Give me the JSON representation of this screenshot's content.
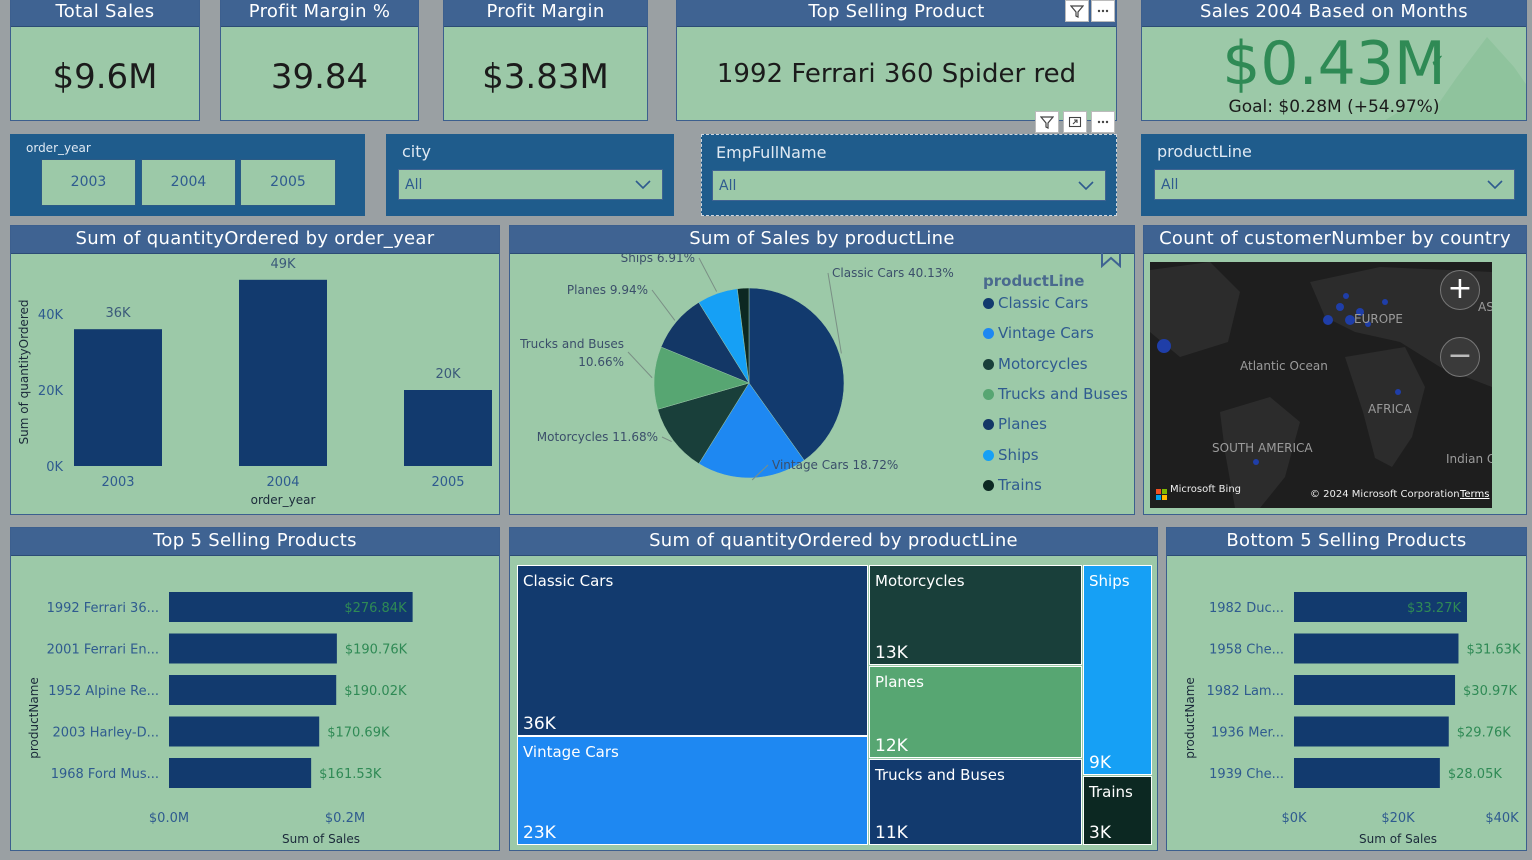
{
  "kpis": {
    "total_sales": {
      "title": "Total Sales",
      "value": "$9.6M"
    },
    "profit_margin_pct": {
      "title": "Profit Margin %",
      "value": "39.84"
    },
    "profit_margin": {
      "title": "Profit Margin",
      "value": "$3.83M"
    },
    "top_product": {
      "title": "Top Selling Product",
      "value": "1992 Ferrari 360 Spider red"
    },
    "sales_2004": {
      "title": "Sales 2004 Based on Months",
      "value": "$0.43M",
      "goal": "Goal: $0.28M (+54.97%)"
    }
  },
  "slicers": {
    "order_year": {
      "title": "order_year",
      "options": [
        "2003",
        "2004",
        "2005"
      ]
    },
    "city": {
      "title": "city",
      "value": "All"
    },
    "emp": {
      "title": "EmpFullName",
      "value": "All"
    },
    "product_line": {
      "title": "productLine",
      "value": "All"
    }
  },
  "visuals": {
    "qty_by_year": {
      "title": "Sum of quantityOrdered by order_year"
    },
    "sales_by_line": {
      "title": "Sum of Sales by productLine"
    },
    "customers_by_country": {
      "title": "Count of customerNumber by country"
    },
    "top5": {
      "title": "Top 5 Selling Products"
    },
    "qty_by_line": {
      "title": "Sum of quantityOrdered by productLine"
    },
    "bottom5": {
      "title": "Bottom 5 Selling Products"
    }
  },
  "map": {
    "labels": {
      "europe": "EUROPE",
      "atlantic": "Atlantic Ocean",
      "africa": "AFRICA",
      "south_america": "SOUTH AMERICA",
      "indian": "Indian Ocea",
      "as": "AS"
    },
    "credit": "Microsoft Bing",
    "copyright": "© 2024 Microsoft Corporation",
    "terms": "Terms"
  },
  "colors": {
    "card_bg": "#9cc9a8",
    "header_bg": "#3f6392",
    "slicer_bg": "#1f5c8c",
    "bar": "#123a6e",
    "text_blue": "#2f5b8f",
    "value_green": "#2f8a55"
  },
  "chart_data": [
    {
      "type": "bar",
      "title": "Sum of quantityOrdered by order_year",
      "categories": [
        "2003",
        "2004",
        "2005"
      ],
      "values": [
        36000,
        49000,
        20000
      ],
      "data_labels": [
        "36K",
        "49K",
        "20K"
      ],
      "xlabel": "order_year",
      "ylabel": "Sum of quantityOrdered",
      "y_ticks": [
        "0K",
        "20K",
        "40K"
      ],
      "ylim": [
        0,
        50000
      ]
    },
    {
      "type": "pie",
      "title": "Sum of Sales by productLine",
      "legend_title": "productLine",
      "legend_position": "right",
      "slices": [
        {
          "name": "Classic Cars",
          "value": 40.13,
          "label": "Classic Cars 40.13%",
          "color": "#123a6e"
        },
        {
          "name": "Vintage Cars",
          "value": 18.72,
          "label": "Vintage Cars 18.72%",
          "color": "#1e88f2"
        },
        {
          "name": "Motorcycles",
          "value": 11.68,
          "label": "Motorcycles 11.68%",
          "color": "#193f3a"
        },
        {
          "name": "Trucks and Buses",
          "value": 10.66,
          "label": "Trucks and Buses 10.66%",
          "color": "#57a672"
        },
        {
          "name": "Planes",
          "value": 9.94,
          "label": "Planes 9.94%",
          "color": "#133766"
        },
        {
          "name": "Ships",
          "value": 6.91,
          "label": "Ships 6.91%",
          "color": "#16a0f5"
        },
        {
          "name": "Trains",
          "value": 1.96,
          "label": "",
          "color": "#0c2822"
        }
      ]
    },
    {
      "type": "bar",
      "orientation": "horizontal",
      "title": "Top 5 Selling Products",
      "categories": [
        "1992 Ferrari 36...",
        "2001 Ferrari En...",
        "1952 Alpine Re...",
        "2003 Harley-D...",
        "1968 Ford Mus..."
      ],
      "values": [
        276840,
        190760,
        190020,
        170690,
        161530
      ],
      "data_labels": [
        "$276.84K",
        "$190.76K",
        "$190.02K",
        "$170.69K",
        "$161.53K"
      ],
      "xlabel": "Sum of Sales",
      "ylabel": "productName",
      "x_ticks": [
        "$0.0M",
        "$0.2M"
      ],
      "xlim": [
        0,
        300000
      ]
    },
    {
      "type": "treemap",
      "title": "Sum of quantityOrdered by productLine",
      "items": [
        {
          "name": "Classic Cars",
          "value": 36,
          "label": "36K",
          "color": "#123a6e"
        },
        {
          "name": "Vintage Cars",
          "value": 23,
          "label": "23K",
          "color": "#1e88f2"
        },
        {
          "name": "Motorcycles",
          "value": 13,
          "label": "13K",
          "color": "#193f3a"
        },
        {
          "name": "Planes",
          "value": 12,
          "label": "12K",
          "color": "#57a672"
        },
        {
          "name": "Trucks and Buses",
          "value": 11,
          "label": "11K",
          "color": "#123a6e"
        },
        {
          "name": "Ships",
          "value": 9,
          "label": "9K",
          "color": "#16a0f5"
        },
        {
          "name": "Trains",
          "value": 3,
          "label": "3K",
          "color": "#0c2822"
        }
      ]
    },
    {
      "type": "bar",
      "orientation": "horizontal",
      "title": "Bottom 5 Selling Products",
      "categories": [
        "1982 Duc...",
        "1958 Che...",
        "1982 Lam...",
        "1936 Mer...",
        "1939 Che..."
      ],
      "values": [
        33270,
        31630,
        30970,
        29760,
        28050
      ],
      "data_labels": [
        "$33.27K",
        "$31.63K",
        "$30.97K",
        "$29.76K",
        "$28.05K"
      ],
      "xlabel": "Sum of Sales",
      "ylabel": "productName",
      "x_ticks": [
        "$0K",
        "$20K",
        "$40K"
      ],
      "xlim": [
        0,
        40000
      ]
    }
  ]
}
